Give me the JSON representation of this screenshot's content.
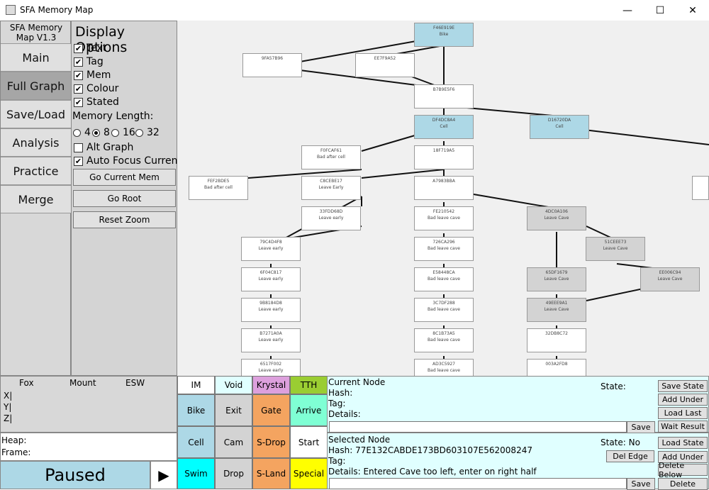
{
  "window": {
    "title": "SFA Memory Map",
    "minimize": "—",
    "maximize": "☐",
    "close": "✕"
  },
  "sidebar": {
    "version": "SFA Memory Map V1.3",
    "items": [
      {
        "label": "Main"
      },
      {
        "label": "Full Graph"
      },
      {
        "label": "Save/Load"
      },
      {
        "label": "Analysis"
      },
      {
        "label": "Practice"
      },
      {
        "label": "Merge"
      }
    ]
  },
  "options": {
    "title": "Display Options",
    "checks": [
      {
        "label": "Text",
        "checked": true
      },
      {
        "label": "Tag",
        "checked": true
      },
      {
        "label": "Mem",
        "checked": true
      },
      {
        "label": "Colour",
        "checked": true
      },
      {
        "label": "Stated",
        "checked": true
      }
    ],
    "memory_length_label": "Memory Length:",
    "memory_options": [
      "4",
      "8",
      "16",
      "32"
    ],
    "memory_selected": "8",
    "alt_graph": {
      "label": "Alt Graph",
      "checked": false
    },
    "auto_focus": {
      "label": "Auto Focus Current",
      "checked": true
    },
    "buttons": {
      "go_current": "Go Current Mem",
      "go_root": "Go Root",
      "reset_zoom": "Reset Zoom"
    }
  },
  "graph": {
    "nodes": [
      {
        "id": "F46E919E",
        "tag": "Bike",
        "color": "blue"
      },
      {
        "id": "9FA57B96",
        "tag": "",
        "color": "white"
      },
      {
        "id": "EE7F9A52",
        "tag": "",
        "color": "white"
      },
      {
        "id": "B7B9E5F6",
        "tag": "",
        "color": "white"
      },
      {
        "id": "DF4DC8A4",
        "tag": "Cell",
        "color": "blue"
      },
      {
        "id": "D16720DA",
        "tag": "Cell",
        "color": "blue"
      },
      {
        "id": "F0FCAF61",
        "tag": "Bad after cell",
        "color": "white"
      },
      {
        "id": "18F719A5",
        "tag": "",
        "color": "white"
      },
      {
        "id": "FEF2BDE5",
        "tag": "Bad after cell",
        "color": "white"
      },
      {
        "id": "C8CEBE17",
        "tag": "Leave Early",
        "color": "white"
      },
      {
        "id": "A7983BBA",
        "tag": "",
        "color": "white"
      },
      {
        "id": "33FDD68D",
        "tag": "Leave early",
        "color": "white"
      },
      {
        "id": "FE210542",
        "tag": "Bad leave cave",
        "color": "white"
      },
      {
        "id": "4DC0A106",
        "tag": "Leave Cave",
        "color": "gray"
      },
      {
        "id": "79C4D4F8",
        "tag": "Leave early",
        "color": "white"
      },
      {
        "id": "726CA296",
        "tag": "Bad leave cave",
        "color": "white"
      },
      {
        "id": "51CEEE73",
        "tag": "Leave Cave",
        "color": "gray"
      },
      {
        "id": "6F04C817",
        "tag": "Leave early",
        "color": "white"
      },
      {
        "id": "E58448CA",
        "tag": "Bad leave cave",
        "color": "white"
      },
      {
        "id": "65DF1679",
        "tag": "Leave Cave",
        "color": "gray"
      },
      {
        "id": "EE006C94",
        "tag": "Leave Cave",
        "color": "gray"
      },
      {
        "id": "9B8184D8",
        "tag": "Leave early",
        "color": "white"
      },
      {
        "id": "3C7DF288",
        "tag": "Bad leave cave",
        "color": "white"
      },
      {
        "id": "49EEE9A1",
        "tag": "Leave Cave",
        "color": "gray"
      },
      {
        "id": "B7271A0A",
        "tag": "Leave early",
        "color": "white"
      },
      {
        "id": "8C1B73A5",
        "tag": "Bad leave cave",
        "color": "white"
      },
      {
        "id": "32DB8C72",
        "tag": "",
        "color": "white"
      },
      {
        "id": "6517F002",
        "tag": "Leave early",
        "color": "white"
      },
      {
        "id": "AD3C5927",
        "tag": "Bad leave cave",
        "color": "white"
      },
      {
        "id": "003A2FD8",
        "tag": "",
        "color": "white"
      }
    ]
  },
  "coords": {
    "headers": [
      "Fox",
      "Mount",
      "ESW"
    ],
    "rows": [
      "X|",
      "Y|",
      "Z|"
    ]
  },
  "heap": {
    "heap_label": "Heap:",
    "frame_label": "Frame:"
  },
  "status": {
    "paused": "Paused",
    "play_icon": "▶"
  },
  "tags": {
    "row0": [
      {
        "label": "IM",
        "color": "#ffffff"
      },
      {
        "label": "Void",
        "color": "#e0ffff"
      },
      {
        "label": "Krystal",
        "color": "#dda0dd"
      },
      {
        "label": "TTH",
        "color": "#9acd32"
      }
    ],
    "row1": [
      {
        "label": "Bike",
        "color": "#add8e6"
      },
      {
        "label": "Exit",
        "color": "#d3d3d3"
      },
      {
        "label": "Gate",
        "color": "#f4a460"
      },
      {
        "label": "Arrive",
        "color": "#7fffd4"
      }
    ],
    "row2": [
      {
        "label": "Cell",
        "color": "#add8e6"
      },
      {
        "label": "Cam",
        "color": "#d3d3d3"
      },
      {
        "label": "S-Drop",
        "color": "#f4a460"
      },
      {
        "label": "Start",
        "color": "#ffffff"
      }
    ],
    "row3": [
      {
        "label": "Swim",
        "color": "#00ffff"
      },
      {
        "label": "Drop",
        "color": "#d3d3d3"
      },
      {
        "label": "S-Land",
        "color": "#f4a460"
      },
      {
        "label": "Special",
        "color": "#ffff00"
      }
    ]
  },
  "current_node": {
    "title": "Current Node",
    "hash": "Hash:",
    "tag": "Tag:",
    "details": "Details:",
    "state": "State:",
    "buttons": {
      "save_state": "Save State",
      "add_under": "Add Under",
      "load_last": "Load Last",
      "wait_result": "Wait Result",
      "save": "Save"
    }
  },
  "selected_node": {
    "title": "Selected Node",
    "hash": "Hash: 77E132CABDE173BD603107E562008247",
    "tag": "Tag:",
    "details": "Details: Entered Cave too left, enter on right half",
    "state": "State: No",
    "buttons": {
      "load_state": "Load State",
      "del_edge": "Del Edge",
      "add_under": "Add Under",
      "delete_below": "Delete Below",
      "save": "Save",
      "delete": "Delete"
    }
  }
}
